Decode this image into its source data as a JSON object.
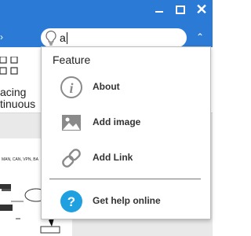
{
  "search": {
    "query": "a"
  },
  "ribbon": {
    "label_line1": "acing",
    "label_line2": "tinuous"
  },
  "document": {
    "snippet": "MAN, CAN, VPN, BA"
  },
  "popup": {
    "header": "Feature",
    "items": [
      {
        "label": "About",
        "icon": "info-icon"
      },
      {
        "label": "Add image",
        "icon": "image-icon"
      },
      {
        "label": "Add Link",
        "icon": "link-icon"
      },
      {
        "label": "Get help online",
        "icon": "help-icon"
      }
    ]
  },
  "colors": {
    "titlebar": "#2b7bd6",
    "help_icon": "#1fa0e0",
    "icon_gray": "#8a8a8a"
  }
}
